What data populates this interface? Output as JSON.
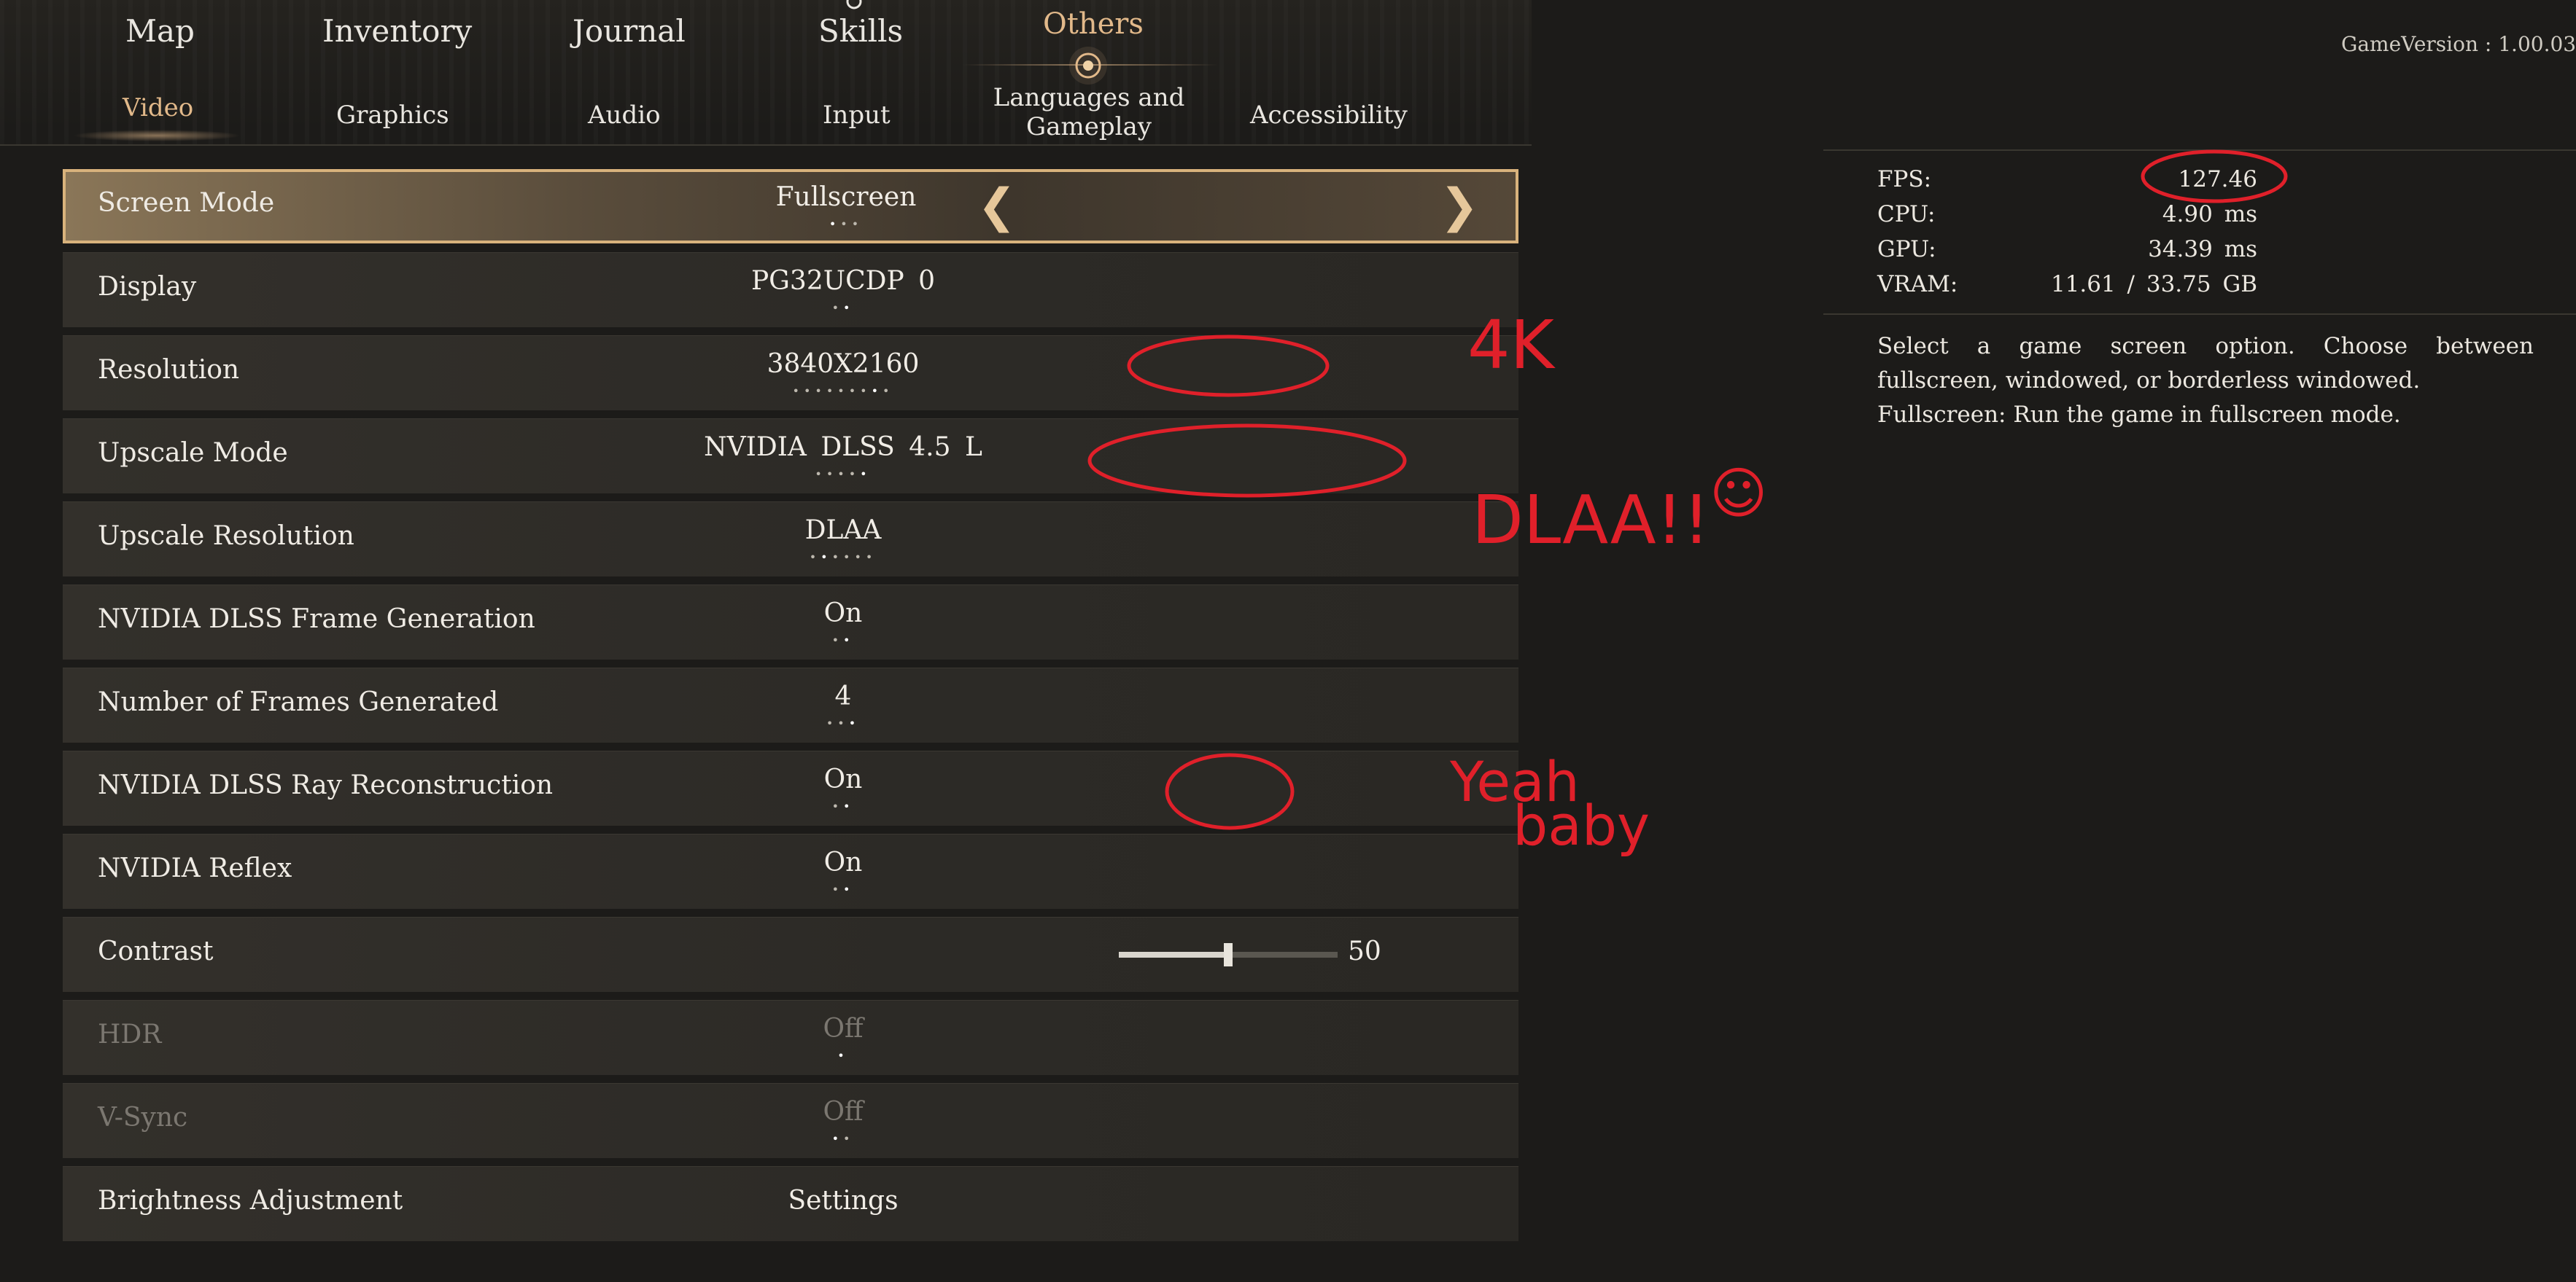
{
  "main_tabs": [
    {
      "label": "Map"
    },
    {
      "label": "Inventory"
    },
    {
      "label": "Journal"
    },
    {
      "label": "Skills"
    },
    {
      "label": "Others",
      "active": true
    }
  ],
  "sub_tabs": [
    {
      "label": "Video",
      "active": true
    },
    {
      "label": "Graphics"
    },
    {
      "label": "Audio"
    },
    {
      "label": "Input"
    },
    {
      "label": "Languages and Gameplay"
    },
    {
      "label": "Accessibility"
    }
  ],
  "version_text": "GameVersion : 1.00.03",
  "settings": [
    {
      "label": "Screen Mode",
      "value": "Fullscreen",
      "selected": true,
      "enabled": true
    },
    {
      "label": "Display",
      "value": "PG32UCDP 0",
      "enabled": true
    },
    {
      "label": "Resolution",
      "value": "3840X2160",
      "enabled": true
    },
    {
      "label": "Upscale Mode",
      "value": "NVIDIA DLSS 4.5 L",
      "enabled": true
    },
    {
      "label": "Upscale Resolution",
      "value": "DLAA",
      "enabled": true
    },
    {
      "label": "NVIDIA DLSS Frame Generation",
      "value": "On",
      "enabled": true
    },
    {
      "label": "Number of Frames Generated",
      "value": "4",
      "enabled": true
    },
    {
      "label": "NVIDIA DLSS Ray Reconstruction",
      "value": "On",
      "enabled": true
    },
    {
      "label": "NVIDIA Reflex",
      "value": "On",
      "enabled": true
    },
    {
      "label": "Contrast",
      "value": "50",
      "type": "slider",
      "level_fraction": 0.5,
      "enabled": true
    },
    {
      "label": "HDR",
      "value": "Off",
      "enabled": false
    },
    {
      "label": "V-Sync",
      "value": "Off",
      "enabled": false
    },
    {
      "label": "Brightness Adjustment",
      "value": "Settings",
      "type": "button",
      "enabled": true
    }
  ],
  "stats": {
    "fps": {
      "label": "FPS:",
      "value": "127.46"
    },
    "cpu": {
      "label": "CPU:",
      "value": "4.90 ms"
    },
    "gpu": {
      "label": "GPU:",
      "value": "34.39 ms"
    },
    "vram": {
      "label": "VRAM:",
      "value": "11.61 / 33.75 GB"
    }
  },
  "description": {
    "line1": "Select a game screen option. Choose between fullscreen, windowed, or borderless windowed.",
    "line2": "Fullscreen: Run the game in fullscreen mode."
  },
  "annotations": {
    "res_note": "4K",
    "dlaa_note": "DLAA!!",
    "smile": "☺",
    "yeah": "Yeah",
    "baby": "baby"
  },
  "colors": {
    "accent_gold": "#e2b98a",
    "selected_border": "#d8b27c",
    "annotation_red": "#e0202a"
  },
  "icons": {
    "left_arrow": "chevron-left-icon",
    "right_arrow": "chevron-right-icon",
    "others_emblem": "emblem-icon"
  }
}
